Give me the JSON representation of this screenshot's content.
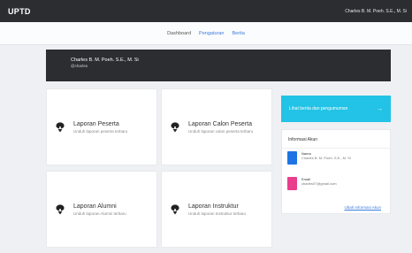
{
  "topbar": {
    "brand": "UPTD",
    "user_name": "Charles B. M. Poeh. S.E., M. Si"
  },
  "nav": {
    "items": [
      "Dashboard",
      "Pengaturan",
      "Berita"
    ],
    "active_index": 1
  },
  "profile": {
    "name": "Charles B. M. Poeh. S.E., M. Si",
    "username": "@charles"
  },
  "cards": [
    {
      "title": "Laporan Peserta",
      "subtitle": "Unduh laporan peserta terbaru",
      "icon": "download-cloud-icon"
    },
    {
      "title": "Laporan Calon Peserta",
      "subtitle": "Unduh laporan calon peserta terbaru",
      "icon": "download-cloud-icon"
    },
    {
      "title": "Laporan Alumni",
      "subtitle": "Unduh laporan Alumni terbaru",
      "icon": "download-cloud-icon"
    },
    {
      "title": "Laporan Instruktur",
      "subtitle": "Unduh laporan Instruktur terbaru",
      "icon": "download-cloud-icon"
    }
  ],
  "banner": {
    "text": "Lihat berita dan pengumuman",
    "arrow": "→"
  },
  "account": {
    "title": "Informasi Akun",
    "name_label": "Nama",
    "name_value": "Charles B. M. Poeh. S.E., M. Si",
    "email_label": "Email",
    "email_value": "charles07@gmail.com",
    "edit_link": "Ubah informasi Akun"
  },
  "colors": {
    "dark": "#2b2d31",
    "accent": "#22c3e6",
    "blue": "#1e74e3",
    "pink": "#e83e8c",
    "link": "#3b7ddd"
  }
}
